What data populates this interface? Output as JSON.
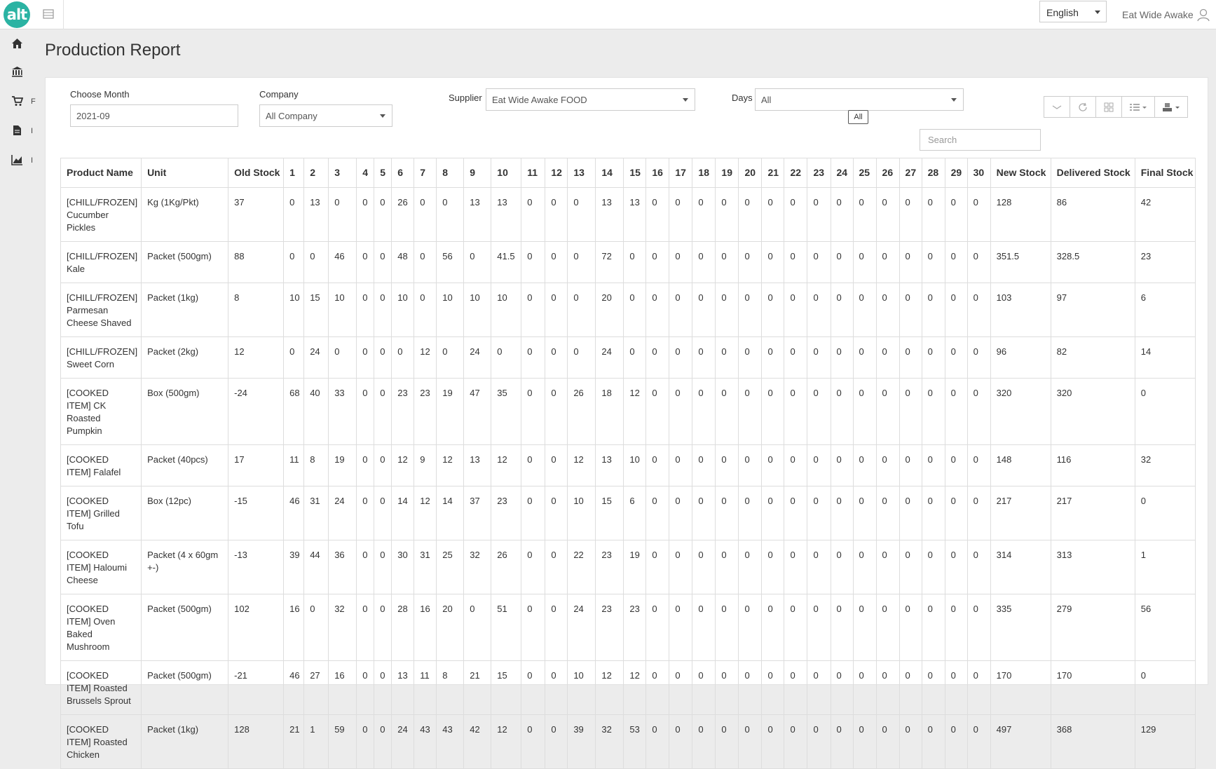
{
  "app": {
    "logo_text": "alt",
    "language": "English",
    "user_name": "Eat Wide Awake"
  },
  "sidebar": {
    "items": [
      {
        "icon": "home-icon",
        "label": ""
      },
      {
        "icon": "bank-icon",
        "label": ""
      },
      {
        "icon": "cart-icon",
        "label": "F"
      },
      {
        "icon": "document-icon",
        "label": "I"
      },
      {
        "icon": "chart-icon",
        "label": "I"
      }
    ]
  },
  "page": {
    "title": "Production Report"
  },
  "filters": {
    "month_label": "Choose Month",
    "month_value": "2021-09",
    "company_label": "Company",
    "company_value": "All Company",
    "supplier_label": "Supplier",
    "supplier_value": "Eat Wide Awake FOOD",
    "days_label": "Days",
    "days_value": "All",
    "days_tooltip": "All"
  },
  "toolbar": {
    "buttons": [
      "collapse-icon",
      "refresh-icon",
      "grid-view-icon",
      "columns-icon",
      "export-icon"
    ]
  },
  "search": {
    "placeholder": "Search"
  },
  "table": {
    "headers": [
      "Product Name",
      "Unit",
      "Old Stock",
      "1",
      "2",
      "3",
      "4",
      "5",
      "6",
      "7",
      "8",
      "9",
      "10",
      "11",
      "12",
      "13",
      "14",
      "15",
      "16",
      "17",
      "18",
      "19",
      "20",
      "21",
      "22",
      "23",
      "24",
      "25",
      "26",
      "27",
      "28",
      "29",
      "30",
      "New Stock",
      "Delivered Stock",
      "Final Stock"
    ],
    "rows": [
      [
        "[CHILL/FROZEN] Cucumber Pickles",
        "Kg (1Kg/Pkt)",
        "37",
        "0",
        "13",
        "0",
        "0",
        "0",
        "26",
        "0",
        "0",
        "13",
        "13",
        "0",
        "0",
        "0",
        "13",
        "13",
        "0",
        "0",
        "0",
        "0",
        "0",
        "0",
        "0",
        "0",
        "0",
        "0",
        "0",
        "0",
        "0",
        "0",
        "0",
        "128",
        "86",
        "42"
      ],
      [
        "[CHILL/FROZEN] Kale",
        "Packet (500gm)",
        "88",
        "0",
        "0",
        "46",
        "0",
        "0",
        "48",
        "0",
        "56",
        "0",
        "41.5",
        "0",
        "0",
        "0",
        "72",
        "0",
        "0",
        "0",
        "0",
        "0",
        "0",
        "0",
        "0",
        "0",
        "0",
        "0",
        "0",
        "0",
        "0",
        "0",
        "0",
        "351.5",
        "328.5",
        "23"
      ],
      [
        "[CHILL/FROZEN] Parmesan Cheese Shaved",
        "Packet (1kg)",
        "8",
        "10",
        "15",
        "10",
        "0",
        "0",
        "10",
        "0",
        "10",
        "10",
        "10",
        "0",
        "0",
        "0",
        "20",
        "0",
        "0",
        "0",
        "0",
        "0",
        "0",
        "0",
        "0",
        "0",
        "0",
        "0",
        "0",
        "0",
        "0",
        "0",
        "0",
        "103",
        "97",
        "6"
      ],
      [
        "[CHILL/FROZEN] Sweet Corn",
        "Packet (2kg)",
        "12",
        "0",
        "24",
        "0",
        "0",
        "0",
        "0",
        "12",
        "0",
        "24",
        "0",
        "0",
        "0",
        "0",
        "24",
        "0",
        "0",
        "0",
        "0",
        "0",
        "0",
        "0",
        "0",
        "0",
        "0",
        "0",
        "0",
        "0",
        "0",
        "0",
        "0",
        "96",
        "82",
        "14"
      ],
      [
        "[COOKED ITEM] CK Roasted Pumpkin",
        "Box (500gm)",
        "-24",
        "68",
        "40",
        "33",
        "0",
        "0",
        "23",
        "23",
        "19",
        "47",
        "35",
        "0",
        "0",
        "26",
        "18",
        "12",
        "0",
        "0",
        "0",
        "0",
        "0",
        "0",
        "0",
        "0",
        "0",
        "0",
        "0",
        "0",
        "0",
        "0",
        "0",
        "320",
        "320",
        "0"
      ],
      [
        "[COOKED ITEM] Falafel",
        "Packet (40pcs)",
        "17",
        "11",
        "8",
        "19",
        "0",
        "0",
        "12",
        "9",
        "12",
        "13",
        "12",
        "0",
        "0",
        "12",
        "13",
        "10",
        "0",
        "0",
        "0",
        "0",
        "0",
        "0",
        "0",
        "0",
        "0",
        "0",
        "0",
        "0",
        "0",
        "0",
        "0",
        "148",
        "116",
        "32"
      ],
      [
        "[COOKED ITEM] Grilled Tofu",
        "Box (12pc)",
        "-15",
        "46",
        "31",
        "24",
        "0",
        "0",
        "14",
        "12",
        "14",
        "37",
        "23",
        "0",
        "0",
        "10",
        "15",
        "6",
        "0",
        "0",
        "0",
        "0",
        "0",
        "0",
        "0",
        "0",
        "0",
        "0",
        "0",
        "0",
        "0",
        "0",
        "0",
        "217",
        "217",
        "0"
      ],
      [
        "[COOKED ITEM] Haloumi Cheese",
        "Packet (4 x 60gm +-)",
        "-13",
        "39",
        "44",
        "36",
        "0",
        "0",
        "30",
        "31",
        "25",
        "32",
        "26",
        "0",
        "0",
        "22",
        "23",
        "19",
        "0",
        "0",
        "0",
        "0",
        "0",
        "0",
        "0",
        "0",
        "0",
        "0",
        "0",
        "0",
        "0",
        "0",
        "0",
        "314",
        "313",
        "1"
      ],
      [
        "[COOKED ITEM] Oven Baked Mushroom",
        "Packet (500gm)",
        "102",
        "16",
        "0",
        "32",
        "0",
        "0",
        "28",
        "16",
        "20",
        "0",
        "51",
        "0",
        "0",
        "24",
        "23",
        "23",
        "0",
        "0",
        "0",
        "0",
        "0",
        "0",
        "0",
        "0",
        "0",
        "0",
        "0",
        "0",
        "0",
        "0",
        "0",
        "335",
        "279",
        "56"
      ],
      [
        "[COOKED ITEM] Roasted Brussels Sprout",
        "Packet (500gm)",
        "-21",
        "46",
        "27",
        "16",
        "0",
        "0",
        "13",
        "11",
        "8",
        "21",
        "15",
        "0",
        "0",
        "10",
        "12",
        "12",
        "0",
        "0",
        "0",
        "0",
        "0",
        "0",
        "0",
        "0",
        "0",
        "0",
        "0",
        "0",
        "0",
        "0",
        "0",
        "170",
        "170",
        "0"
      ],
      [
        "[COOKED ITEM] Roasted Chicken",
        "Packet (1kg)",
        "128",
        "21",
        "1",
        "59",
        "0",
        "0",
        "24",
        "43",
        "43",
        "42",
        "12",
        "0",
        "0",
        "39",
        "32",
        "53",
        "0",
        "0",
        "0",
        "0",
        "0",
        "0",
        "0",
        "0",
        "0",
        "0",
        "0",
        "0",
        "0",
        "0",
        "0",
        "497",
        "368",
        "129"
      ]
    ]
  }
}
